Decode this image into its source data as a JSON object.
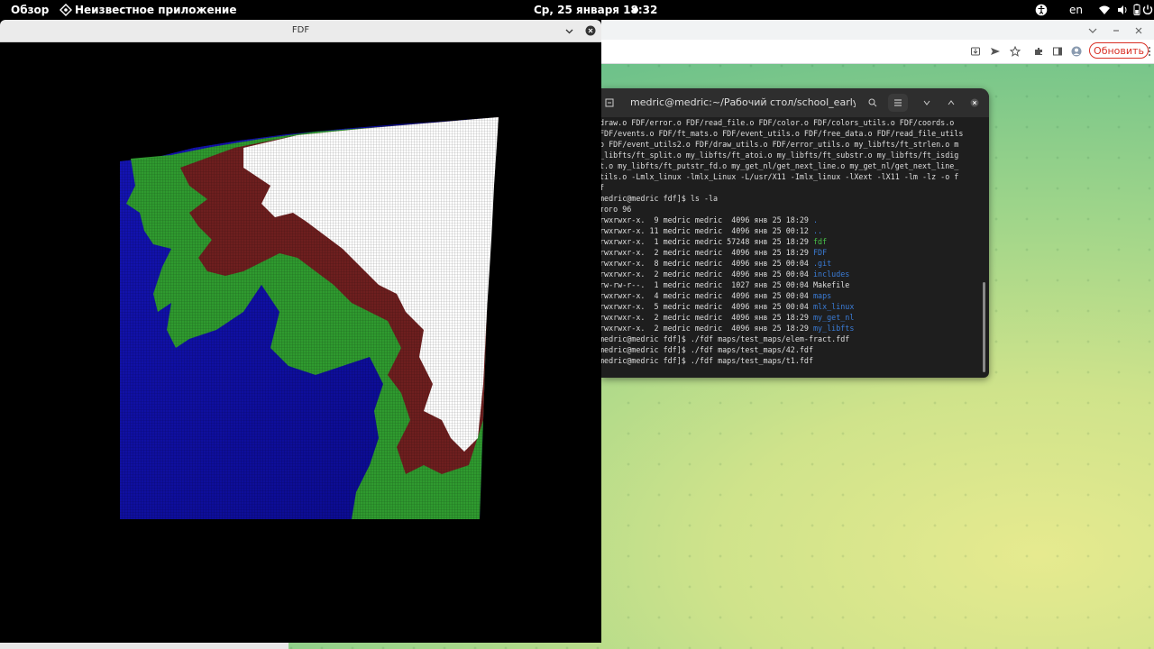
{
  "topbar": {
    "overview": "Обзор",
    "app_name": "Неизвестное приложение",
    "datetime": "Ср, 25 января  18:32",
    "lang": "en"
  },
  "browser": {
    "update_label": "Обновить"
  },
  "terminal": {
    "title": "medric@medric:~/Рабочий стол/school_early_projec…",
    "lines": [
      {
        "segments": [
          {
            "t": "draw.o FDF/error.o FDF/read_file.o FDF/color.o FDF/colors_utils.o FDF/coords.o"
          }
        ]
      },
      {
        "segments": [
          {
            "t": "FDF/events.o FDF/ft_mats.o FDF/event_utils.o FDF/free_data.o FDF/read_file_utils"
          }
        ]
      },
      {
        "segments": [
          {
            "t": "o FDF/event_utils2.o FDF/draw_utils.o FDF/error_utils.o my_libfts/ft_strlen.o m"
          }
        ]
      },
      {
        "segments": [
          {
            "t": "_libfts/ft_split.o my_libfts/ft_atoi.o my_libfts/ft_substr.o my_libfts/ft_isdig"
          }
        ]
      },
      {
        "segments": [
          {
            "t": "t.o my_libfts/ft_putstr_fd.o my_get_nl/get_next_line.o my_get_nl/get_next_line_"
          }
        ]
      },
      {
        "segments": [
          {
            "t": "tils.o -Lmlx_linux -lmlx_Linux -L/usr/X11 -Imlx_linux -lXext -lX11 -lm -lz -o f"
          }
        ]
      },
      {
        "segments": [
          {
            "t": "f"
          }
        ]
      },
      {
        "segments": [
          {
            "t": "medric@medric fdf]$ ls -la"
          }
        ]
      },
      {
        "segments": [
          {
            "t": "того 96"
          }
        ]
      },
      {
        "segments": [
          {
            "t": "rwxrwxr-x.  9 medric medric  4096 янв 25 18:29 "
          },
          {
            "t": ".",
            "c": "blue"
          }
        ]
      },
      {
        "segments": [
          {
            "t": "rwxrwxr-x. 11 medric medric  4096 янв 25 00:12 "
          },
          {
            "t": "..",
            "c": "blue"
          }
        ]
      },
      {
        "segments": [
          {
            "t": "rwxrwxr-x.  1 medric medric 57248 янв 25 18:29 "
          },
          {
            "t": "fdf",
            "c": "green"
          }
        ]
      },
      {
        "segments": [
          {
            "t": "rwxrwxr-x.  2 medric medric  4096 янв 25 18:29 "
          },
          {
            "t": "FDF",
            "c": "blue"
          }
        ]
      },
      {
        "segments": [
          {
            "t": "rwxrwxr-x.  8 medric medric  4096 янв 25 00:04 "
          },
          {
            "t": ".git",
            "c": "blue"
          }
        ]
      },
      {
        "segments": [
          {
            "t": "rwxrwxr-x.  2 medric medric  4096 янв 25 00:04 "
          },
          {
            "t": "includes",
            "c": "blue"
          }
        ]
      },
      {
        "segments": [
          {
            "t": "rw-rw-r--.  1 medric medric  1027 янв 25 00:04 Makefile"
          }
        ]
      },
      {
        "segments": [
          {
            "t": "rwxrwxr-x.  4 medric medric  4096 янв 25 00:04 "
          },
          {
            "t": "maps",
            "c": "blue"
          }
        ]
      },
      {
        "segments": [
          {
            "t": "rwxrwxr-x.  5 medric medric  4096 янв 25 00:04 "
          },
          {
            "t": "mlx_linux",
            "c": "blue"
          }
        ]
      },
      {
        "segments": [
          {
            "t": "rwxrwxr-x.  2 medric medric  4096 янв 25 18:29 "
          },
          {
            "t": "my_get_nl",
            "c": "blue"
          }
        ]
      },
      {
        "segments": [
          {
            "t": "rwxrwxr-x.  2 medric medric  4096 янв 25 18:29 "
          },
          {
            "t": "my_libfts",
            "c": "blue"
          }
        ]
      },
      {
        "segments": [
          {
            "t": "medric@medric fdf]$ ./fdf maps/test_maps/elem-fract.fdf"
          }
        ]
      },
      {
        "segments": [
          {
            "t": "medric@medric fdf]$ ./fdf maps/test_maps/42.fdf"
          }
        ]
      },
      {
        "segments": [
          {
            "t": "medric@medric fdf]$ ./fdf maps/test_maps/t1.fdf"
          }
        ]
      }
    ]
  },
  "fdf_window": {
    "title": "FDF"
  },
  "colors": {
    "water": "#1010a0",
    "land": "#2f9a2f",
    "rock": "#6a1f1f",
    "snow": "#ffffff",
    "accent_red": "#d93025"
  },
  "icons": [
    "gnome-app-icon",
    "accessibility-icon",
    "wifi-icon",
    "volume-icon",
    "battery-icon",
    "power-icon",
    "install-icon",
    "send-icon",
    "star-icon",
    "extensions-icon",
    "sidebar-icon",
    "profile-icon",
    "more-icon",
    "search-icon",
    "menu-icon",
    "minimize-icon",
    "maximize-icon",
    "close-icon",
    "chevron-down-icon"
  ]
}
